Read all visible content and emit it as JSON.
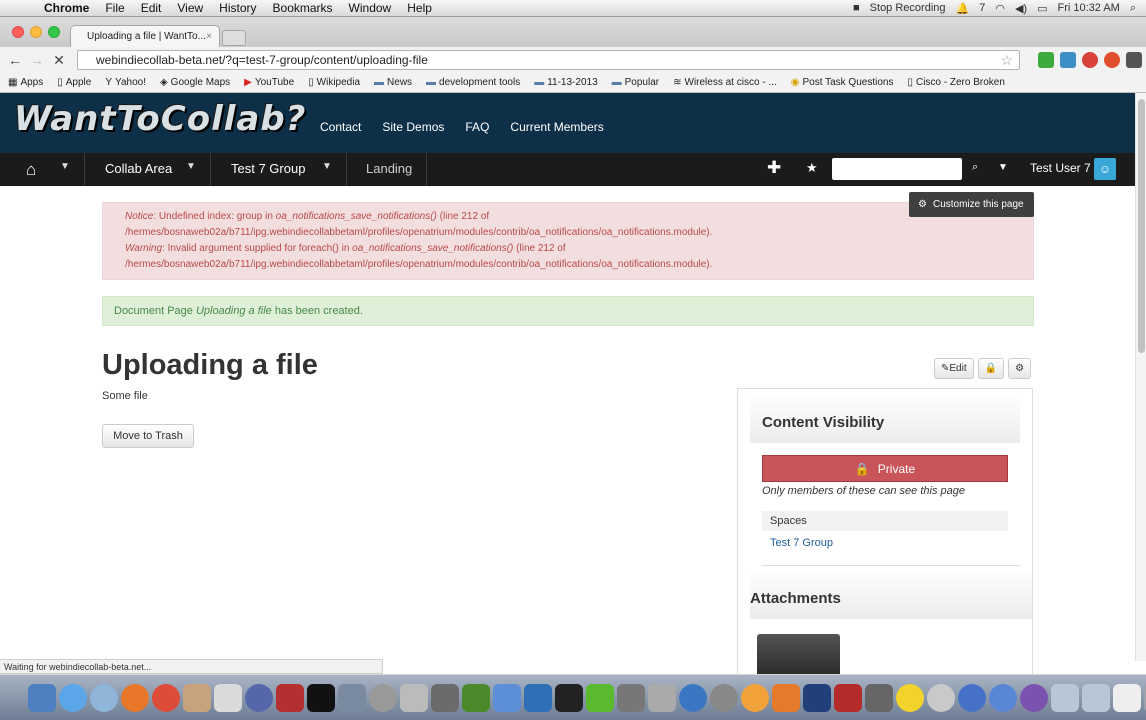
{
  "menubar": {
    "app": "Chrome",
    "items": [
      "File",
      "Edit",
      "View",
      "History",
      "Bookmarks",
      "Window",
      "Help"
    ],
    "stop_recording": "Stop Recording",
    "badge": "7",
    "clock": "Fri 10:32 AM"
  },
  "tab": {
    "title": "Uploading a file | WantTo..."
  },
  "omnibox": {
    "url": "webindiecollab-beta.net/?q=test-7-group/content/uploading-file"
  },
  "bookmarks": [
    "Apps",
    "Apple",
    "Yahoo!",
    "Google Maps",
    "YouTube",
    "Wikipedia",
    "News",
    "development tools",
    "11-13-2013",
    "Popular",
    "Wireless at cisco - ...",
    "Post Task Questions",
    "Cisco - Zero Broken"
  ],
  "site": {
    "logo": "WantToCollab?",
    "nav": [
      "Contact",
      "Site Demos",
      "FAQ",
      "Current Members"
    ],
    "crumbs": [
      "Collab Area",
      "Test 7 Group",
      "Landing"
    ],
    "user": "Test User 7",
    "customize": "Customize this page"
  },
  "alert": {
    "notice_label": "Notice",
    "notice_text": ": Undefined index: group in ",
    "notice_fn": "oa_notifications_save_notifications()",
    "notice_line": " (line 212 of",
    "notice_path": "/hermes/bosnaweb02a/b711/ipg.webindiecollabbetaml/profiles/openatrium/modules/contrib/oa_notifications/oa_notifications.module).",
    "warning_label": "Warning",
    "warning_text": ": Invalid argument supplied for foreach() in ",
    "warning_fn": "oa_notifications_save_notifications()",
    "warning_line": " (line 212 of",
    "warning_path": "/hermes/bosnaweb02a/b711/ipg.webindiecollabbetaml/profiles/openatrium/modules/contrib/oa_notifications/oa_notifications.module)."
  },
  "success": {
    "prefix": "Document Page ",
    "title": "Uploading a file",
    "suffix": " has been created."
  },
  "page": {
    "title": "Uploading a file",
    "body": "Some file",
    "trash": "Move to Trash",
    "edit": "Edit"
  },
  "visibility": {
    "heading": "Content Visibility",
    "private": "Private",
    "note": "Only members of these can see this page",
    "spaces_label": "Spaces",
    "space": "Test 7 Group"
  },
  "attachments": {
    "heading": "Attachments"
  },
  "status": "Waiting for webindiecollab-beta.net..."
}
